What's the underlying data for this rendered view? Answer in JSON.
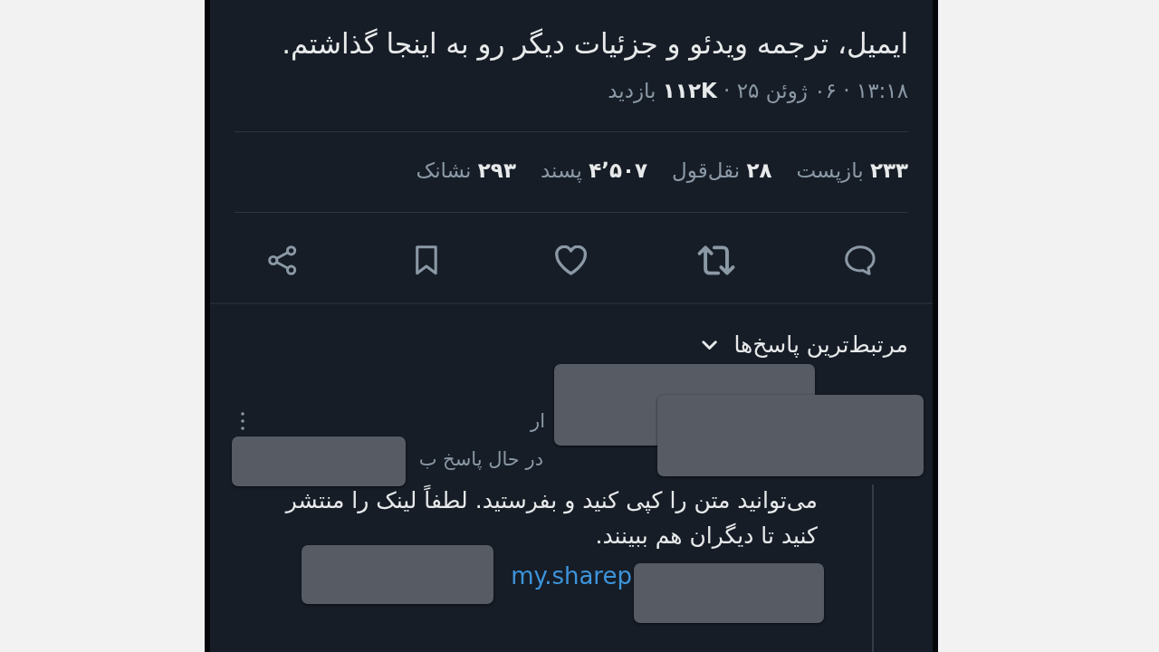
{
  "post": {
    "text": "ایمیل، ترجمه ویدئو و جزئیات دیگر رو به اینجا گذاشتم.",
    "meta": "۱۳:۱۸ · ۰۶ ژوئن ۲۵ · **۱۱۲K** بازدید"
  },
  "stats": [
    {
      "count": "۲۳۳",
      "label": "بازپست"
    },
    {
      "count": "۲۸",
      "label": "نقل‌قول"
    },
    {
      "count": "۴٬۵۰۷",
      "label": "پسند"
    },
    {
      "count": "۲۹۳",
      "label": "نشانک"
    }
  ],
  "actions": [
    {
      "kind": "reply"
    },
    {
      "kind": "repost"
    },
    {
      "kind": "like"
    },
    {
      "kind": "bookmark"
    },
    {
      "kind": "share"
    }
  ],
  "reply_sort": {
    "label": "مرتبط‌ترین پاسخ‌ها"
  },
  "reply": {
    "header_text": "ار",
    "replying_to": "در حال پاسخ ب",
    "text": "می‌توانید متن را کپی کنید و بفرستید. لطفاً لینک را منتشر کنید تا دیگران هم ببینند.",
    "link": "my.sharep"
  }
}
